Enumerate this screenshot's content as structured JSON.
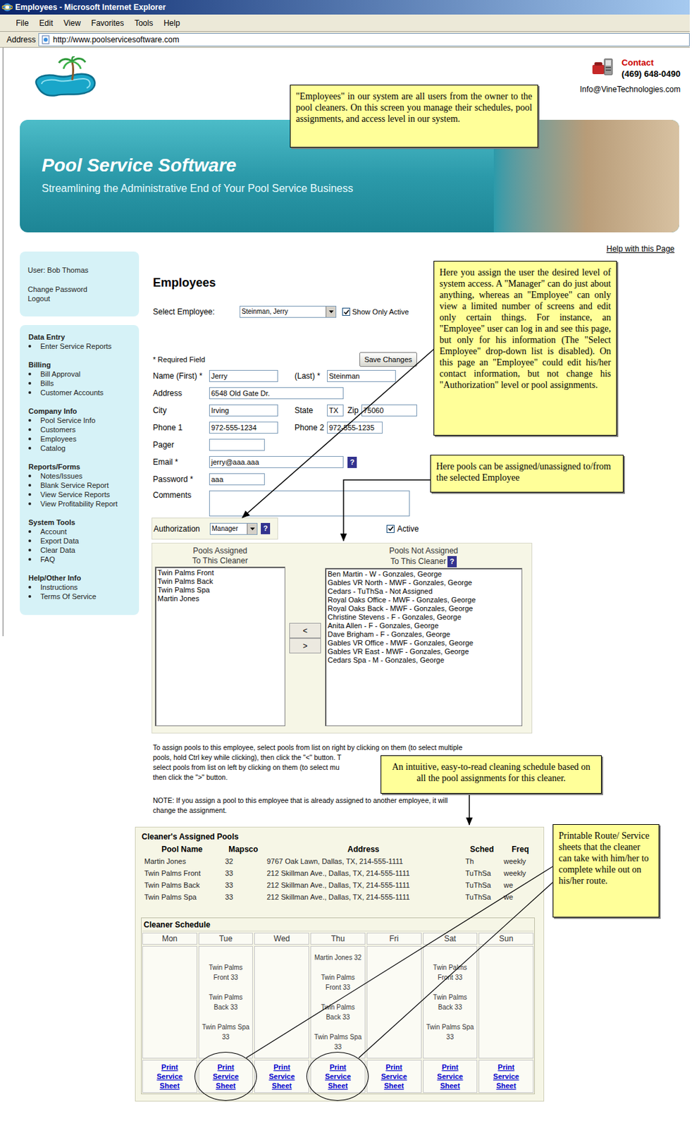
{
  "window": {
    "title": "Employees - Microsoft Internet Explorer"
  },
  "menu": [
    "File",
    "Edit",
    "View",
    "Favorites",
    "Tools",
    "Help"
  ],
  "address_bar": {
    "label": "Address",
    "url": "http://www.poolservicesoftware.com"
  },
  "contact": {
    "label": "Contact",
    "phone": "(469) 648-0490",
    "email": "Info@VineTechnologies.com"
  },
  "banner": {
    "title": "Pool Service Software",
    "tagline": "Streamlining the Administrative End of Your Pool Service Business"
  },
  "help_link": "Help with this Page",
  "user_box": {
    "user": "User: Bob Thomas",
    "links": [
      "Change Password",
      "Logout"
    ]
  },
  "sidebar": {
    "sections": [
      {
        "title": "Data Entry",
        "items": [
          "Enter Service Reports"
        ]
      },
      {
        "title": "Billing",
        "items": [
          "Bill Approval",
          "Bills",
          "Customer Accounts"
        ]
      },
      {
        "title": "Company Info",
        "items": [
          "Pool Service Info",
          "Customers",
          "Employees",
          "Catalog"
        ]
      },
      {
        "title": "Reports/Forms",
        "items": [
          "Notes/Issues",
          "Blank Service Report",
          "View Service Reports",
          "View Profitability Report"
        ]
      },
      {
        "title": "System Tools",
        "items": [
          "Account",
          "Export Data",
          "Clear Data",
          "FAQ"
        ]
      },
      {
        "title": "Help/Other Info",
        "items": [
          "Instructions",
          "Terms Of Service"
        ]
      }
    ]
  },
  "page_title": "Employees",
  "select_employee": {
    "label": "Select Employee:",
    "value": "Steinman, Jerry",
    "show_only_active": {
      "label": "Show Only Active",
      "checked": true
    }
  },
  "required_note": "* Required Field",
  "save_button": "Save Changes",
  "form": {
    "first_name": {
      "label": "Name (First) *",
      "value": "Jerry"
    },
    "last_name": {
      "label": "(Last) *",
      "value": "Steinman"
    },
    "address": {
      "label": "Address",
      "value": "6548 Old Gate Dr."
    },
    "city": {
      "label": "City",
      "value": "Irving"
    },
    "state": {
      "label": "State",
      "value": "TX"
    },
    "zip": {
      "label": "Zip",
      "value": "75060"
    },
    "phone1": {
      "label": "Phone 1",
      "value": "972-555-1234"
    },
    "phone2": {
      "label": "Phone 2",
      "value": "972-555-1235"
    },
    "pager": {
      "label": "Pager",
      "value": ""
    },
    "email": {
      "label": "Email *",
      "value": "jerry@aaa.aaa",
      "help": "?"
    },
    "password": {
      "label": "Password *",
      "value": "aaa"
    },
    "comments": {
      "label": "Comments",
      "value": ""
    },
    "authorization": {
      "label": "Authorization",
      "value": "Manager",
      "help": "?"
    },
    "active": {
      "label": "Active",
      "checked": true
    }
  },
  "pools_assigned": {
    "title_lines": [
      "Pools Assigned",
      "To This Cleaner"
    ],
    "items": [
      {
        "label": "Twin Palms Front",
        "selected": false
      },
      {
        "label": "Twin Palms Back",
        "selected": false
      },
      {
        "label": "Twin Palms Spa",
        "selected": false
      },
      {
        "label": "Martin Jones",
        "selected": false
      }
    ]
  },
  "move_buttons": [
    "<",
    ">"
  ],
  "pools_not_assigned": {
    "title_lines": [
      "Pools Not Assigned",
      "To This Cleaner"
    ],
    "help": "?",
    "items": [
      {
        "label": "Ben Martin - W - Gonzales, George",
        "selected": false
      },
      {
        "label": "Gables VR North - MWF - Gonzales, George",
        "selected": false
      },
      {
        "label": "Cedars - TuThSa - Not Assigned",
        "selected": false
      },
      {
        "label": "Royal Oaks Office - MWF - Gonzales, George",
        "selected": false
      },
      {
        "label": "Royal Oaks Back - MWF - Gonzales, George",
        "selected": false
      },
      {
        "label": "Christine Stevens - F - Gonzales, George",
        "selected": false
      },
      {
        "label": "Anita Allen - F - Gonzales, George",
        "selected": false
      },
      {
        "label": "Dave Brigham - F - Gonzales, George",
        "selected": false
      },
      {
        "label": "Gables VR Office - MWF - Gonzales, George",
        "selected": false
      },
      {
        "label": "Gables VR East - MWF - Gonzales, George",
        "selected": false
      },
      {
        "label": "Cedars Spa - M - Gonzales, George",
        "selected": false
      }
    ]
  },
  "instructions_lines": [
    "To assign pools to this employee, select pools from list on right by clicking on them (to select multiple",
    "pools, hold Ctrl key while clicking), then click the \"<\" button. T",
    "select pools from list on left by clicking on them (to select mu",
    "then click the \">\" button."
  ],
  "note_lines": [
    "NOTE: If you assign a pool to this employee that is already assigned to another employee, it will",
    "change the assignment."
  ],
  "assigned_pools_table": {
    "title": "Cleaner's Assigned Pools",
    "columns": [
      "Pool Name",
      "Mapsco",
      "Address",
      "Sched",
      "Freq"
    ],
    "rows": [
      [
        "Martin Jones",
        "32",
        "9767 Oak Lawn, Dallas, TX, 214-555-1111",
        "Th",
        "weekly"
      ],
      [
        "Twin Palms Front",
        "33",
        "212 Skillman Ave., Dallas, TX, 214-555-1111",
        "TuThSa",
        "weekly"
      ],
      [
        "Twin Palms Back",
        "33",
        "212 Skillman Ave., Dallas, TX, 214-555-1111",
        "TuThSa",
        "we"
      ],
      [
        "Twin Palms Spa",
        "33",
        "212 Skillman Ave., Dallas, TX, 214-555-1111",
        "TuThSa",
        "we"
      ]
    ]
  },
  "schedule": {
    "title": "Cleaner Schedule",
    "days": [
      {
        "day": "Mon",
        "entries": [],
        "print_link_lines": [
          "Print",
          "Service",
          "Sheet"
        ],
        "circled": false
      },
      {
        "day": "Tue",
        "entries": [
          {
            "lines": [
              "Twin Palms",
              "Front 33"
            ]
          },
          {
            "lines": [
              "Twin Palms",
              "Back 33"
            ]
          },
          {
            "lines": [
              "Twin Palms Spa",
              "33"
            ]
          }
        ],
        "print_link_lines": [
          "Print",
          "Service",
          "Sheet"
        ],
        "circled": true
      },
      {
        "day": "Wed",
        "entries": [],
        "print_link_lines": [
          "Print",
          "Service",
          "Sheet"
        ],
        "circled": false
      },
      {
        "day": "Thu",
        "entries": [
          {
            "lines": [
              "Martin Jones 32"
            ]
          },
          {
            "lines": [
              "Twin Palms",
              "Front 33"
            ]
          },
          {
            "lines": [
              "Twin Palms",
              "Back 33"
            ]
          },
          {
            "lines": [
              "Twin Palms Spa",
              "33"
            ]
          }
        ],
        "print_link_lines": [
          "Print",
          "Service",
          "Sheet"
        ],
        "circled": true
      },
      {
        "day": "Fri",
        "entries": [],
        "print_link_lines": [
          "Print",
          "Service",
          "Sheet"
        ],
        "circled": false
      },
      {
        "day": "Sat",
        "entries": [
          {
            "lines": [
              "Twin Palms",
              "Front 33"
            ]
          },
          {
            "lines": [
              "Twin Palms",
              "Back 33"
            ]
          },
          {
            "lines": [
              "Twin Palms Spa",
              "33"
            ]
          }
        ],
        "print_link_lines": [
          "Print",
          "Service",
          "Sheet"
        ],
        "circled": false
      },
      {
        "day": "Sun",
        "entries": [],
        "print_link_lines": [
          "Print",
          "Service",
          "Sheet"
        ],
        "circled": false
      }
    ]
  },
  "annotations": {
    "employees_note": "\"Employees\" in our system are all users from the owner to the pool cleaners. On this screen you manage their schedules, pool assignments, and access level in our system.",
    "authorization_note": "Here you assign the user the desired level of system access. A \"Manager\" can do just about anything, whereas an \"Employee\" can only view a limited number of screens and edit only certain things. For instance, an \"Employee\" user can log in and see this page, but only for his information (The \"Select Employee\" drop-down list is disabled). On this page an \"Employee\" could edit his/her contact information, but not change his \"Authorization\" level or pool assignments.",
    "pools_note": "Here pools can be assigned/unassigned to/from the selected Employee",
    "schedule_note": "An intuitive, easy-to-read cleaning schedule based on all the pool assignments for this cleaner.",
    "print_note": "Printable Route/ Service sheets that the cleaner can take with him/her to complete while out on his/her route."
  }
}
